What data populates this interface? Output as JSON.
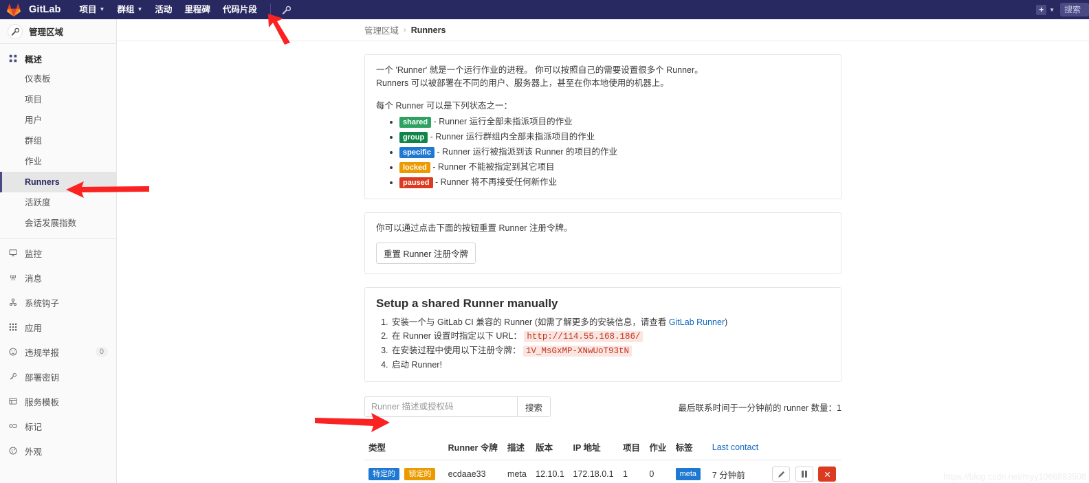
{
  "navbar": {
    "brand": "GitLab",
    "items": [
      {
        "label": "项目",
        "caret": true
      },
      {
        "label": "群组",
        "caret": true
      },
      {
        "label": "活动",
        "caret": false
      },
      {
        "label": "里程碑",
        "caret": false
      },
      {
        "label": "代码片段",
        "caret": false
      }
    ],
    "wrench_icon": "wrench-icon",
    "plus_label": "+",
    "search_placeholder": "搜索"
  },
  "sidebar": {
    "header_title": "管理区域",
    "overview": {
      "label": "概述",
      "icon": "overview-grid-icon",
      "children": [
        {
          "label": "仪表板",
          "active": false
        },
        {
          "label": "项目",
          "active": false
        },
        {
          "label": "用户",
          "active": false
        },
        {
          "label": "群组",
          "active": false
        },
        {
          "label": "作业",
          "active": false
        },
        {
          "label": "Runners",
          "active": true
        },
        {
          "label": "活跃度",
          "active": false
        },
        {
          "label": "会话发展指数",
          "active": false
        }
      ]
    },
    "rows": [
      {
        "label": "监控",
        "icon": "monitor-icon",
        "badge": ""
      },
      {
        "label": "消息",
        "icon": "broadcast-icon",
        "badge": ""
      },
      {
        "label": "系统钩子",
        "icon": "hook-icon",
        "badge": ""
      },
      {
        "label": "应用",
        "icon": "apps-icon",
        "badge": ""
      },
      {
        "label": "违规举报",
        "icon": "abuse-icon",
        "badge": "0"
      },
      {
        "label": "部署密钥",
        "icon": "key-icon",
        "badge": ""
      },
      {
        "label": "服务模板",
        "icon": "template-icon",
        "badge": ""
      },
      {
        "label": "标记",
        "icon": "labels-icon",
        "badge": ""
      },
      {
        "label": "外观",
        "icon": "appearance-icon",
        "badge": ""
      }
    ]
  },
  "breadcrumb": {
    "root": "管理区域",
    "separator": "›",
    "current": "Runners"
  },
  "info_panel": {
    "para1_line1": "一个 'Runner' 就是一个运行作业的进程。 你可以按照自己的需要设置很多个 Runner。",
    "para1_line2": "Runners 可以被部署在不同的用户、服务器上，甚至在你本地使用的机器上。",
    "para2": "每个 Runner 可以是下列状态之一：",
    "states": [
      {
        "tag": "shared",
        "color": "#2da160",
        "text": "- Runner 运行全部未指派项目的作业"
      },
      {
        "tag": "group",
        "color": "#108548",
        "text": "- Runner 运行群组内全部未指派项目的作业"
      },
      {
        "tag": "specific",
        "color": "#1f78d1",
        "text": "- Runner 运行被指派到该 Runner 的项目的作业"
      },
      {
        "tag": "locked",
        "color": "#eb9b00",
        "text": "- Runner 不能被指定到其它项目"
      },
      {
        "tag": "paused",
        "color": "#db3b21",
        "text": "- Runner 将不再接受任何新作业"
      }
    ]
  },
  "reset_panel": {
    "text": "你可以通过点击下面的按钮重置 Runner 注册令牌。",
    "button_label": "重置 Runner 注册令牌"
  },
  "setup_panel": {
    "title": "Setup a shared Runner manually",
    "step1_pre": "安装一个与 GitLab CI 兼容的 Runner (如需了解更多的安装信息，请查看 ",
    "step1_link": "GitLab Runner",
    "step1_post": ")",
    "step2_pre": "在 Runner 设置时指定以下 URL：",
    "step2_code": "http://114.55.168.186/",
    "step3_pre": "在安装过程中使用以下注册令牌：",
    "step3_code": "1V_MsGxMP-XNwUoT93tN",
    "step4": "启动 Runner!"
  },
  "search": {
    "placeholder": "Runner 描述或授权码",
    "value": "",
    "button_label": "搜索"
  },
  "count": {
    "text": "最后联系时间于一分钟前的 runner 数量：1"
  },
  "table": {
    "headers": [
      "类型",
      "Runner 令牌",
      "描述",
      "版本",
      "IP 地址",
      "项目",
      "作业",
      "标签",
      "Last contact",
      ""
    ],
    "rows": [
      {
        "type_tags": [
          {
            "label": "特定的",
            "color": "#1f78d1"
          },
          {
            "label": "锁定的",
            "color": "#eb9b00"
          }
        ],
        "token": "ecdaae33",
        "description": "meta",
        "version": "12.10.1",
        "ip": "172.18.0.1",
        "projects": "1",
        "jobs": "0",
        "tags": [
          {
            "label": "meta",
            "color": "#1f78d1"
          }
        ],
        "last_contact": "7 分钟前",
        "actions": [
          {
            "name": "edit-runner-button",
            "icon": "pencil-icon"
          },
          {
            "name": "pause-runner-button",
            "icon": "pause-icon"
          },
          {
            "name": "remove-runner-button",
            "icon": "close-x-icon"
          }
        ]
      }
    ]
  },
  "watermark": {
    "text": "https://blog.csdn.net/myy1066883508"
  },
  "colors": {
    "navbar_bg": "#292961",
    "accent": "#1068bf",
    "danger": "#db3b21",
    "annotation_arrow": "#fb2222"
  }
}
